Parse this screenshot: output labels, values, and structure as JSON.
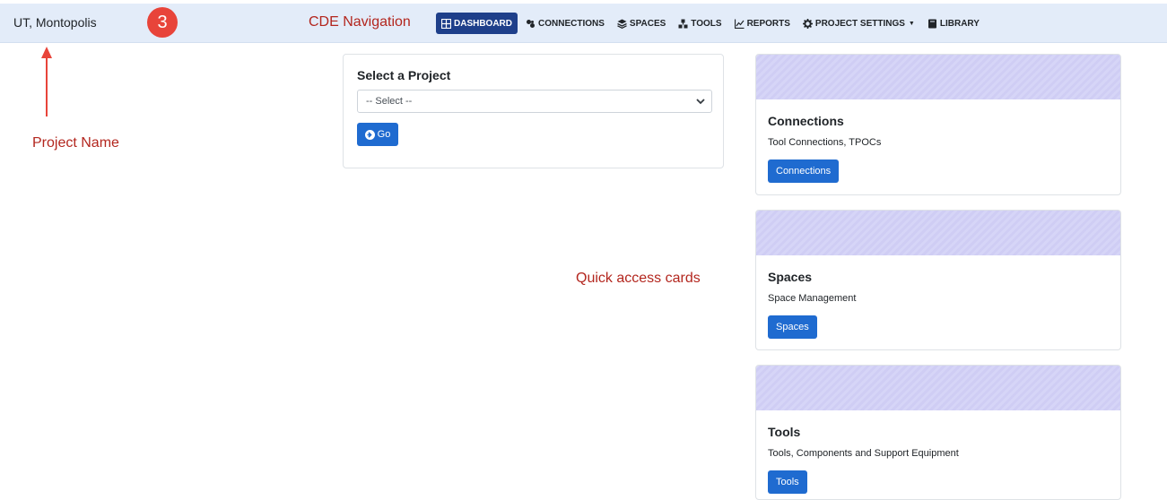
{
  "header": {
    "project_name": "UT, Montopolis",
    "step_badge": "3",
    "nav_annotation": "CDE Navigation"
  },
  "nav": {
    "items": [
      {
        "label": "DASHBOARD",
        "icon": "grid-icon",
        "active": true
      },
      {
        "label": "CONNECTIONS",
        "icon": "connections-icon"
      },
      {
        "label": "SPACES",
        "icon": "layers-icon"
      },
      {
        "label": "TOOLS",
        "icon": "tools-icon"
      },
      {
        "label": "REPORTS",
        "icon": "chart-icon"
      },
      {
        "label": "PROJECT SETTINGS",
        "icon": "gear-icon",
        "dropdown": true
      },
      {
        "label": "LIBRARY",
        "icon": "book-icon"
      }
    ]
  },
  "annotations": {
    "project_name": "Project Name",
    "quick_access": "Quick access cards"
  },
  "project_select": {
    "title": "Select a Project",
    "selected": "-- Select --",
    "go_label": "Go"
  },
  "cards": [
    {
      "title": "Connections",
      "description": "Tool Connections, TPOCs",
      "button": "Connections"
    },
    {
      "title": "Spaces",
      "description": "Space Management",
      "button": "Spaces"
    },
    {
      "title": "Tools",
      "description": "Tools, Components and Support Equipment",
      "button": "Tools"
    }
  ],
  "colors": {
    "navbar_bg": "#e3ecf9",
    "active_nav": "#1e3f8a",
    "primary_button": "#1f6bd0",
    "annotation_red": "#b3261e",
    "badge_red": "#e8443a",
    "card_banner": "#d6d5f7"
  }
}
